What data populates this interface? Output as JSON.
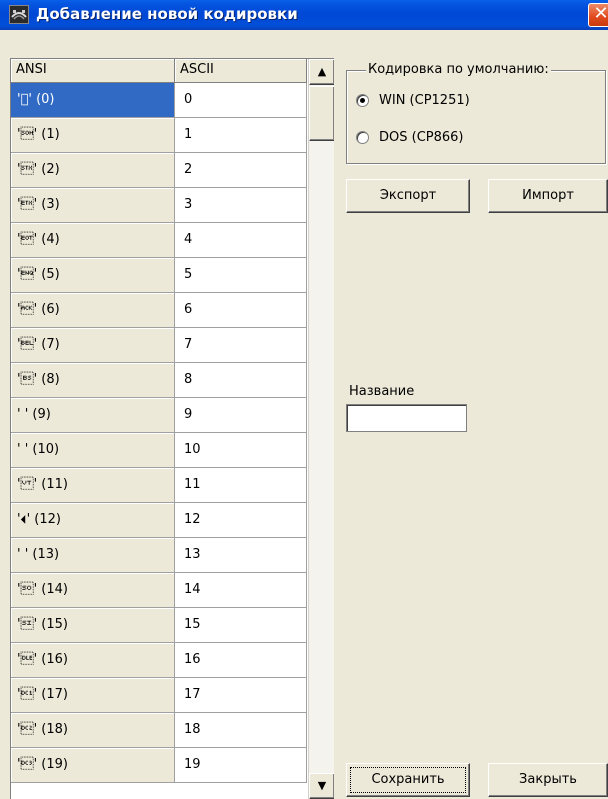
{
  "window": {
    "title": "Добавление новой кодировки",
    "close_glyph": "✕"
  },
  "grid": {
    "columns": [
      "ANSI",
      "ASCII"
    ],
    "rows": [
      {
        "ansi": "'\u0000' (0)",
        "ascii": "0"
      },
      {
        "ansi": "'\u0001' (1)",
        "ascii": "1"
      },
      {
        "ansi": "'\u0002' (2)",
        "ascii": "2"
      },
      {
        "ansi": "'\u0003' (3)",
        "ascii": "3"
      },
      {
        "ansi": "'\u0004' (4)",
        "ascii": "4"
      },
      {
        "ansi": "'\u0005' (5)",
        "ascii": "5"
      },
      {
        "ansi": "'\u0006' (6)",
        "ascii": "6"
      },
      {
        "ansi": "'\u0007' (7)",
        "ascii": "7"
      },
      {
        "ansi": "'\b' (8)",
        "ascii": "8"
      },
      {
        "ansi": "'\t' (9)",
        "ascii": "9"
      },
      {
        "ansi": "'\n' (10)",
        "ascii": "10"
      },
      {
        "ansi": "'\u000b' (11)",
        "ascii": "11"
      },
      {
        "ansi": "'\f' (12)",
        "ascii": "12"
      },
      {
        "ansi": "'\r' (13)",
        "ascii": "13"
      },
      {
        "ansi": "'\u000e' (14)",
        "ascii": "14"
      },
      {
        "ansi": "'\u000f' (15)",
        "ascii": "15"
      },
      {
        "ansi": "'\u0010' (16)",
        "ascii": "16"
      },
      {
        "ansi": "'\u0011' (17)",
        "ascii": "17"
      },
      {
        "ansi": "'\u0012' (18)",
        "ascii": "18"
      },
      {
        "ansi": "'\u0013' (19)",
        "ascii": "19"
      }
    ],
    "selected_row": 0,
    "scroll_up_glyph": "▲",
    "scroll_down_glyph": "▼"
  },
  "encoding_group": {
    "label": "Кодировка по умолчанию:",
    "options": [
      {
        "label": "WIN (CP1251)",
        "checked": true
      },
      {
        "label": "DOS (CP866)",
        "checked": false
      }
    ]
  },
  "buttons": {
    "export": "Экспорт",
    "import": "Импорт",
    "save": "Сохранить",
    "close": "Закрыть"
  },
  "name_field": {
    "label": "Название",
    "value": ""
  }
}
